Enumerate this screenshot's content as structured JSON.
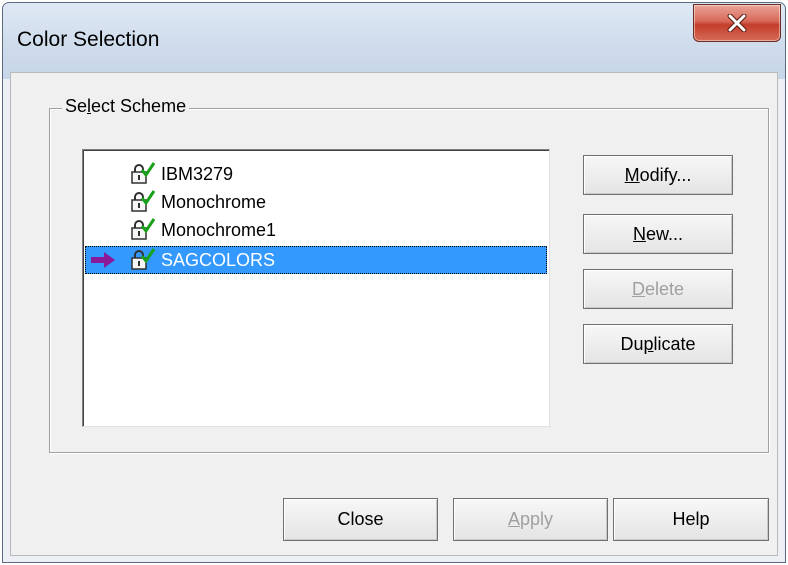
{
  "window": {
    "title": "Color Selection"
  },
  "group": {
    "label_pre": "Se",
    "label_key": "l",
    "label_post": "ect Scheme"
  },
  "schemes": {
    "items": [
      {
        "label": "IBM3279",
        "selected": false
      },
      {
        "label": "Monochrome",
        "selected": false
      },
      {
        "label": "Monochrome1",
        "selected": false
      },
      {
        "label": "SAGCOLORS",
        "selected": true
      }
    ]
  },
  "side_buttons": {
    "modify": {
      "key": "M",
      "rest": "odify..."
    },
    "new": {
      "key": "N",
      "rest": "ew..."
    },
    "delete": {
      "key": "D",
      "rest": "elete"
    },
    "duplicate": {
      "pre": "Du",
      "key": "p",
      "rest": "licate"
    }
  },
  "bottom_buttons": {
    "close": "Close",
    "apply": {
      "key": "A",
      "rest": "pply"
    },
    "help": "Help"
  },
  "colors": {
    "selection_bg": "#3399ff",
    "arrow": "#8b1a9a",
    "lock_check": "#1aa11a",
    "close_button": "#c8412f"
  },
  "icons": {
    "list_item_icon": "lock-check-icon",
    "current_marker": "arrow-right-icon",
    "close": "close-icon"
  }
}
